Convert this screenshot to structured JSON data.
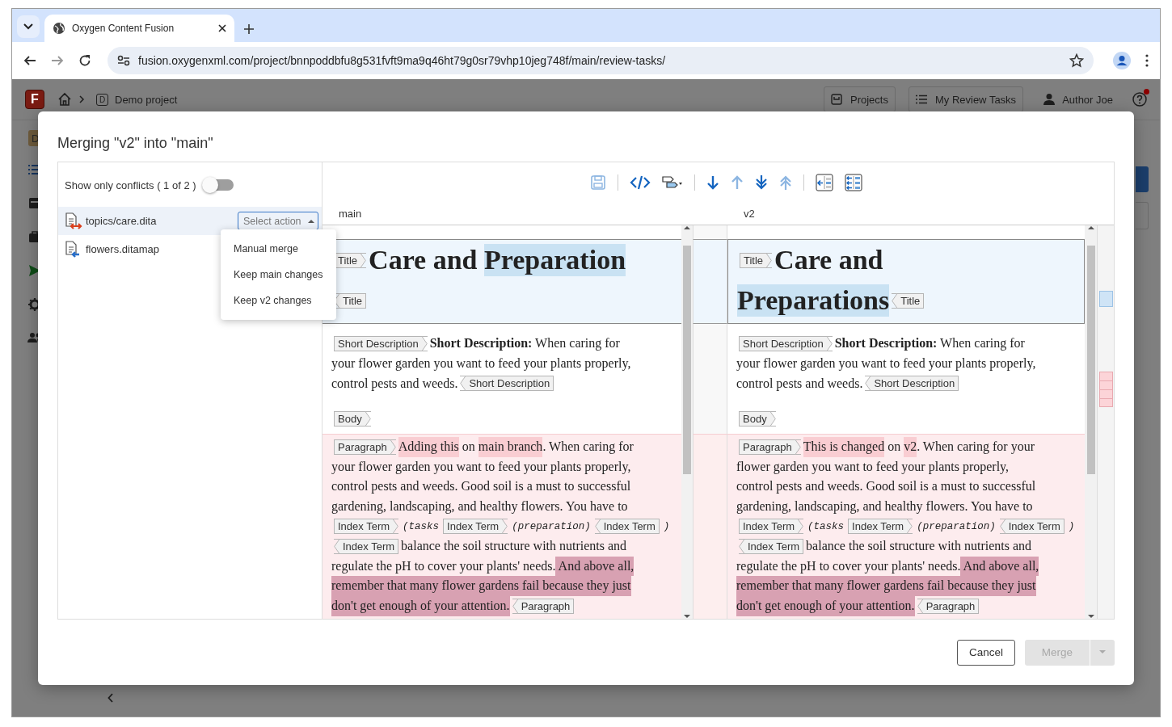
{
  "browser": {
    "tab_title": "Oxygen Content Fusion",
    "url": "fusion.oxygenxml.com/project/bnnpoddbfu8g531fvft9ma9q46ht79g0sr79vhp10jeg748f/main/review-tasks/"
  },
  "app_header": {
    "logo": "F",
    "project_badge": "D",
    "project": "Demo project",
    "nav_buttons": [
      "Projects",
      "My Review Tasks"
    ],
    "user": "Author Joe",
    "help_notification": true
  },
  "rail": {
    "badge": "D"
  },
  "dialog": {
    "title": "Merging \"v2\" into \"main\"",
    "conflicts_toggle": {
      "label": "Show only conflicts ( 1 of 2 )",
      "on": false
    },
    "files": [
      {
        "name": "topics/care.dita",
        "kind": "conflict",
        "selected": true,
        "action": {
          "placeholder": "Select action",
          "expanded": true
        }
      },
      {
        "name": "flowers.ditamap",
        "kind": "incoming",
        "selected": false
      }
    ],
    "action_menu": [
      "Manual merge",
      "Keep main changes",
      "Keep v2 changes"
    ],
    "toolbar": [
      {
        "kind": "save",
        "disabled": true
      },
      {
        "kind": "separator"
      },
      {
        "kind": "source",
        "disabled": false
      },
      {
        "kind": "tags",
        "disabled": false
      },
      {
        "kind": "separator"
      },
      {
        "kind": "next",
        "disabled": false
      },
      {
        "kind": "prev",
        "disabled": true
      },
      {
        "kind": "next_conflict",
        "disabled": false
      },
      {
        "kind": "prev_conflict",
        "disabled": true
      },
      {
        "kind": "separator"
      },
      {
        "kind": "copy_one",
        "disabled": false
      },
      {
        "kind": "copy_all",
        "disabled": false
      }
    ],
    "panes": [
      {
        "label": "main"
      },
      {
        "label": "v2"
      }
    ],
    "rows": [
      {
        "kind": "title",
        "main": [
          [
            {
              "kind": "start",
              "text": "Title"
            },
            {
              "kind": "title",
              "text": "Care and "
            },
            {
              "kind": "title_change",
              "text": "Preparation"
            }
          ],
          [
            {
              "kind": "end",
              "text": "Title"
            }
          ]
        ],
        "v2": [
          [
            {
              "kind": "start",
              "text": "Title"
            },
            {
              "kind": "title",
              "text": "Care and"
            }
          ],
          [
            {
              "kind": "title_change",
              "text": "Preparations"
            },
            {
              "kind": "end",
              "text": "Title"
            }
          ]
        ]
      },
      {
        "kind": "normal",
        "main": [
          [
            {
              "kind": "start",
              "text": "Short Description"
            },
            {
              "kind": "bold",
              "text": "Short Description:"
            },
            {
              "kind": "text",
              "text": " When caring for"
            }
          ],
          [
            {
              "kind": "text",
              "text": "your flower garden you want to feed your plants properly,"
            }
          ],
          [
            {
              "kind": "text",
              "text": "control pests and weeds."
            },
            {
              "kind": "end",
              "text": "Short Description"
            }
          ]
        ],
        "v2": [
          [
            {
              "kind": "start",
              "text": "Short Description"
            },
            {
              "kind": "bold",
              "text": "Short Description:"
            },
            {
              "kind": "text",
              "text": " When caring for"
            }
          ],
          [
            {
              "kind": "text",
              "text": "your flower garden you want to feed your plants properly,"
            }
          ],
          [
            {
              "kind": "text",
              "text": "control pests and weeds."
            },
            {
              "kind": "end",
              "text": "Short Description"
            }
          ]
        ]
      },
      {
        "kind": "normal",
        "main": [
          [
            {
              "kind": "start",
              "text": "Body"
            }
          ]
        ],
        "v2": [
          [
            {
              "kind": "start",
              "text": "Body"
            }
          ]
        ]
      },
      {
        "kind": "conflict",
        "main": [
          [
            {
              "kind": "start",
              "text": "Paragraph"
            },
            {
              "kind": "change",
              "text": "Adding this"
            },
            {
              "kind": "text",
              "text": " on "
            },
            {
              "kind": "change",
              "text": "main branch"
            },
            {
              "kind": "text",
              "text": ". When caring for"
            }
          ],
          [
            {
              "kind": "text",
              "text": "your flower garden you want to feed your plants properly,"
            }
          ],
          [
            {
              "kind": "text",
              "text": "control pests and weeds. Good soil is a must to successful"
            }
          ],
          [
            {
              "kind": "text",
              "text": "gardening, landscaping, and healthy flowers. You have to"
            }
          ],
          [
            {
              "kind": "start",
              "text": "Index Term"
            },
            {
              "kind": "mono",
              "text": "(tasks"
            },
            {
              "kind": "start",
              "text": "Index Term"
            },
            {
              "kind": "mono",
              "text": "(preparation)"
            },
            {
              "kind": "end",
              "text": "Index Term"
            },
            {
              "kind": "mono",
              "text": ")"
            }
          ],
          [
            {
              "kind": "end",
              "text": "Index Term"
            },
            {
              "kind": "text",
              "text": "balance the soil structure with nutrients and"
            }
          ],
          [
            {
              "kind": "text",
              "text": "regulate the pH to cover your plants' needs."
            },
            {
              "kind": "strong_change",
              "text": " And above all,"
            }
          ],
          [
            {
              "kind": "strong_change",
              "text": "remember that many flower gardens fail because they just"
            }
          ],
          [
            {
              "kind": "strong_change",
              "text": "don't get enough of your attention."
            },
            {
              "kind": "end",
              "text": "Paragraph"
            }
          ]
        ],
        "v2": [
          [
            {
              "kind": "start",
              "text": "Paragraph"
            },
            {
              "kind": "change",
              "text": "This is changed"
            },
            {
              "kind": "text",
              "text": " on "
            },
            {
              "kind": "change",
              "text": "v2"
            },
            {
              "kind": "text",
              "text": ". When caring for your"
            }
          ],
          [
            {
              "kind": "text",
              "text": "flower garden you want to feed your plants properly,"
            }
          ],
          [
            {
              "kind": "text",
              "text": "control pests and weeds. Good soil is a must to successful"
            }
          ],
          [
            {
              "kind": "text",
              "text": "gardening, landscaping, and healthy flowers. You have to"
            }
          ],
          [
            {
              "kind": "start",
              "text": "Index Term"
            },
            {
              "kind": "mono",
              "text": "(tasks"
            },
            {
              "kind": "start",
              "text": "Index Term"
            },
            {
              "kind": "mono",
              "text": "(preparation)"
            },
            {
              "kind": "end",
              "text": "Index Term"
            },
            {
              "kind": "mono",
              "text": ")"
            }
          ],
          [
            {
              "kind": "end",
              "text": "Index Term"
            },
            {
              "kind": "text",
              "text": "balance the soil structure with nutrients and"
            }
          ],
          [
            {
              "kind": "text",
              "text": "regulate the pH to cover your plants' needs."
            },
            {
              "kind": "strong_change",
              "text": " And above all,"
            }
          ],
          [
            {
              "kind": "strong_change",
              "text": "remember that many flower gardens fail because they just"
            }
          ],
          [
            {
              "kind": "strong_change",
              "text": "don't get enough of your attention."
            },
            {
              "kind": "end",
              "text": "Paragraph"
            }
          ]
        ]
      }
    ],
    "buttons": [
      {
        "label": "Cancel",
        "kind": "secondary",
        "disabled": false
      },
      {
        "label": "Merge",
        "kind": "split",
        "disabled": true
      }
    ]
  }
}
